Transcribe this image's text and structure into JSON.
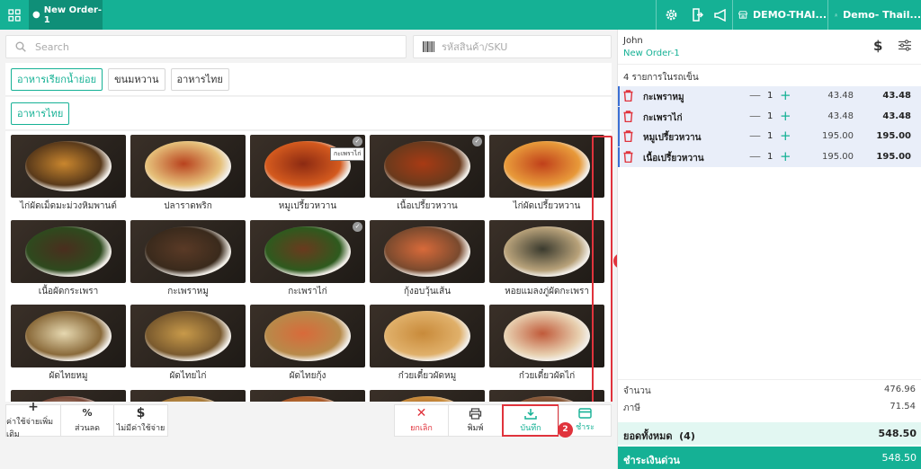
{
  "topbar": {
    "tab_label": "New Order-1",
    "store_label": "DEMO-THAI...",
    "user_label": "Demo- Thail..."
  },
  "search": {
    "placeholder": "Search"
  },
  "sku": {
    "placeholder": "รหัสสินค้า/SKU"
  },
  "categories": {
    "row1": [
      "อาหารเรียกน้ำย่อย",
      "ขนมหวาน",
      "อาหารไทย"
    ],
    "row2": [
      "อาหารไทย"
    ]
  },
  "products": [
    {
      "name": "ไก่ผัดเม็ดมะม่วงหิมพานต์",
      "c1": "#c9862e",
      "c2": "#5a3a1a"
    },
    {
      "name": "ปลาราดพริก",
      "c1": "#b8421e",
      "c2": "#e6c07a"
    },
    {
      "name": "หมูเปรี้ยวหวาน",
      "c1": "#8c2a12",
      "c2": "#d45a1e"
    },
    {
      "name": "เนื้อเปรี้ยวหวาน",
      "c1": "#a83a14",
      "c2": "#6b3a1c"
    },
    {
      "name": "ไก่ผัดเปรี้ยวหวาน",
      "c1": "#c0401a",
      "c2": "#e89a3a"
    },
    {
      "name": "เนื้อผัดกระเพรา",
      "c1": "#4a2e1e",
      "c2": "#2e4a1e"
    },
    {
      "name": "กะเพราหมู",
      "c1": "#5a3a26",
      "c2": "#3a2a1c"
    },
    {
      "name": "กะเพราไก่",
      "c1": "#6a3a1e",
      "c2": "#2e5a1e"
    },
    {
      "name": "กุ้งอบวุ้นเส้น",
      "c1": "#d86a3a",
      "c2": "#7a4a2e"
    },
    {
      "name": "หอยแมลงภู่ผัดกะเพรา",
      "c1": "#3a3a2e",
      "c2": "#b8a27a"
    },
    {
      "name": "ผัดไทยหมู",
      "c1": "#e6d8b0",
      "c2": "#8a6a3a"
    },
    {
      "name": "ผัดไทยไก่",
      "c1": "#c89a4a",
      "c2": "#7a5a2e"
    },
    {
      "name": "ผัดไทยกุ้ง",
      "c1": "#d86a3a",
      "c2": "#b88a4a"
    },
    {
      "name": "ก๋วยเตี๋ยวผัดหมู",
      "c1": "#c88a3a",
      "c2": "#e0b06a"
    },
    {
      "name": "ก๋วยเตี๋ยวผัดไก่",
      "c1": "#c05a3a",
      "c2": "#e8d0b0"
    },
    {
      "name": "",
      "c1": "#d8c8a8",
      "c2": "#7a4a3a"
    },
    {
      "name": "",
      "c1": "#d8b05a",
      "c2": "#a87a3a"
    },
    {
      "name": "",
      "c1": "#d8a03a",
      "c2": "#a85a2a"
    },
    {
      "name": "",
      "c1": "#8a4a2a",
      "c2": "#c88a3a"
    },
    {
      "name": "",
      "c1": "#3a2a1e",
      "c2": "#8a5a3a"
    }
  ],
  "tooltip": "กะเพราไก่",
  "badges": {
    "one": "1",
    "two": "2"
  },
  "actions": {
    "extra_charge": "ค่าใช้จ่ายเพิ่มเติม",
    "discount": "ส่วนลด",
    "no_charge": "ไม่มีค่าใช้จ่าย",
    "cancel": "ยกเลิก",
    "print": "พิมพ์",
    "save": "บันทึก",
    "pay": "ชำระ"
  },
  "cart": {
    "customer": "John",
    "order": "New Order-1",
    "count_label": "4 รายการในรถเข็น",
    "items": [
      {
        "name": "กะเพราหมู",
        "qty": "1",
        "price": "43.48",
        "total": "43.48"
      },
      {
        "name": "กะเพราไก่",
        "qty": "1",
        "price": "43.48",
        "total": "43.48"
      },
      {
        "name": "หมูเปรี้ยวหวาน",
        "qty": "1",
        "price": "195.00",
        "total": "195.00"
      },
      {
        "name": "เนื้อเปรี้ยวหวาน",
        "qty": "1",
        "price": "195.00",
        "total": "195.00"
      }
    ],
    "subtotal_label": "จำนวน",
    "subtotal": "476.96",
    "tax_label": "ภาษี",
    "tax": "71.54",
    "grand_label": "ยอดทั้งหมด",
    "grand_count": "(4)",
    "grand_total": "548.50",
    "quick_pay_label": "ชำระเงินด่วน",
    "quick_pay_total": "548.50"
  },
  "colors": {
    "accent": "#15b195",
    "accent_dark": "#0f8f78",
    "danger": "#e0333c",
    "cart_row": "#e9eef9"
  }
}
